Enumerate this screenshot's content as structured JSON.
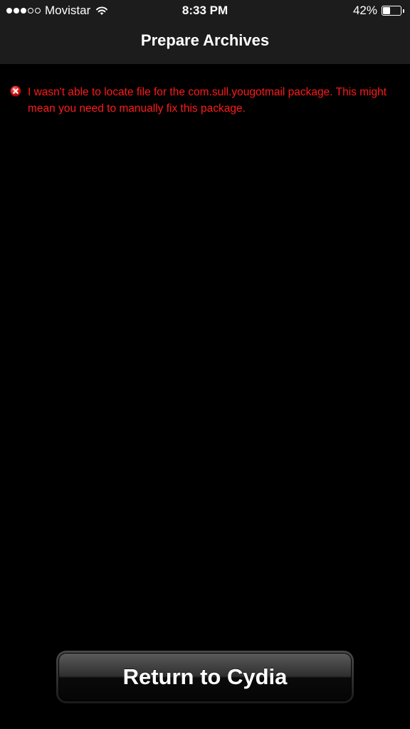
{
  "status_bar": {
    "carrier": "Movistar",
    "signal_bars_filled": 3,
    "signal_bars_total": 5,
    "time": "8:33 PM",
    "battery_percent_label": "42%",
    "battery_level": 0.42
  },
  "nav": {
    "title": "Prepare Archives"
  },
  "error": {
    "message": "I wasn't able to locate file for the com.sull.yougotmail package. This might mean you need to manually fix this package.",
    "color": "#ff1a1a",
    "icon": "error-x-icon"
  },
  "footer": {
    "return_label": "Return to Cydia"
  },
  "colors": {
    "background": "#000000",
    "nav_background": "#1c1c1c",
    "text": "#ffffff"
  }
}
